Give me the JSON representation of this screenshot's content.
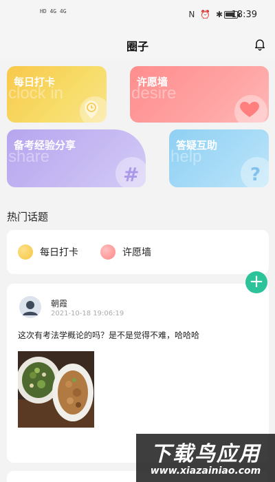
{
  "status_bar": {
    "signal_text": "HD 4G 4G",
    "status_icons": "N ⏰ ✱",
    "time": "18:39"
  },
  "header": {
    "title": "圈子",
    "bell_icon": "bell-icon"
  },
  "category_cards": [
    {
      "label": "每日打卡",
      "watermark": "clock in",
      "icon": "clock-icon",
      "color": "#f8c84a"
    },
    {
      "label": "许愿墙",
      "watermark": "desire",
      "icon": "heart-icon",
      "color": "#ff8d8d"
    },
    {
      "label": "备考经验分享",
      "watermark": "share",
      "icon": "hashtag-icon",
      "color": "#b6a5ee"
    },
    {
      "label": "答疑互助",
      "watermark": "help",
      "icon": "question-icon",
      "color": "#8fd0f3"
    }
  ],
  "hot_topics": {
    "title": "热门话题",
    "items": [
      {
        "label": "每日打卡",
        "color": "#f8c84a"
      },
      {
        "label": "许愿墙",
        "color": "#ff8d8d"
      }
    ]
  },
  "fab": {
    "label": "+"
  },
  "post": {
    "author": "朝霞",
    "timestamp": "2021-10-18 19:06:19",
    "content": "这次有考法学概论的吗？是不是觉得不难，哈哈哈"
  },
  "watermark_brand": {
    "title": "下载鸟应用",
    "url": "www.xiazainiao.com"
  }
}
